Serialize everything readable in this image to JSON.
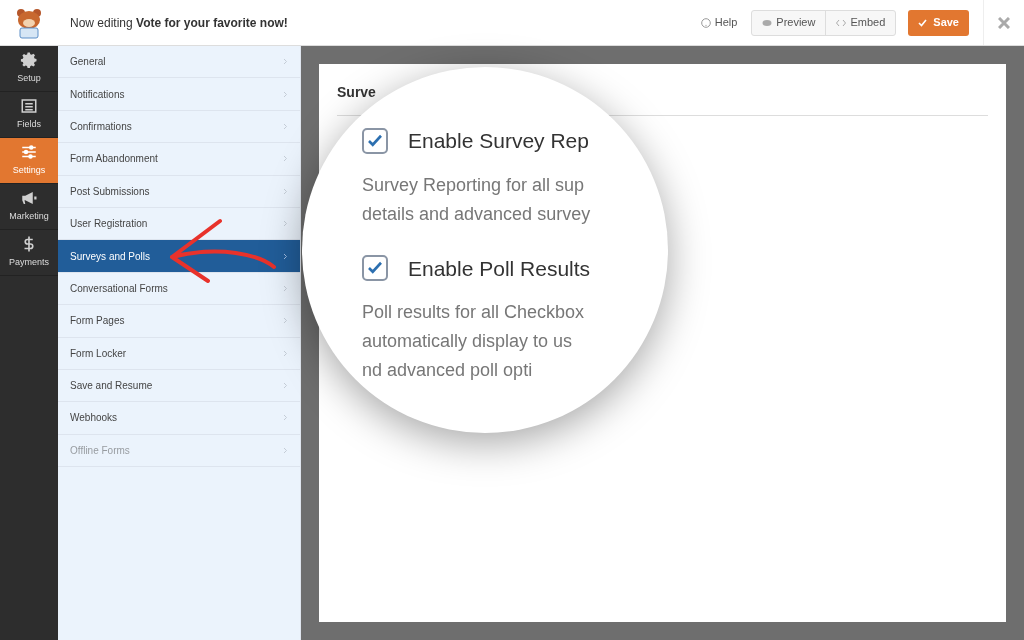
{
  "header": {
    "prefix": "Now editing ",
    "form_name": "Vote for your favorite now!",
    "help": "Help",
    "preview": "Preview",
    "embed": "Embed",
    "save": "Save"
  },
  "nav": [
    {
      "label": "Setup",
      "kind": "gear",
      "selected": false
    },
    {
      "label": "Fields",
      "kind": "fields",
      "selected": false
    },
    {
      "label": "Settings",
      "kind": "sliders",
      "selected": true
    },
    {
      "label": "Marketing",
      "kind": "megaphone",
      "selected": false
    },
    {
      "label": "Payments",
      "kind": "dollar",
      "selected": false
    }
  ],
  "settings_menu": [
    {
      "label": "General",
      "selected": false,
      "disabled": false
    },
    {
      "label": "Notifications",
      "selected": false,
      "disabled": false
    },
    {
      "label": "Confirmations",
      "selected": false,
      "disabled": false
    },
    {
      "label": "Form Abandonment",
      "selected": false,
      "disabled": false
    },
    {
      "label": "Post Submissions",
      "selected": false,
      "disabled": false
    },
    {
      "label": "User Registration",
      "selected": false,
      "disabled": false
    },
    {
      "label": "Surveys and Polls",
      "selected": true,
      "disabled": false
    },
    {
      "label": "Conversational Forms",
      "selected": false,
      "disabled": false
    },
    {
      "label": "Form Pages",
      "selected": false,
      "disabled": false
    },
    {
      "label": "Form Locker",
      "selected": false,
      "disabled": false
    },
    {
      "label": "Save and Resume",
      "selected": false,
      "disabled": false
    },
    {
      "label": "Webhooks",
      "selected": false,
      "disabled": false
    },
    {
      "label": "Offline Forms",
      "selected": false,
      "disabled": true
    }
  ],
  "panel": {
    "title": "Surve"
  },
  "magnifier": {
    "options": [
      {
        "label": "Enable Survey Rep",
        "checked": true,
        "description": [
          "Survey Reporting for all sup",
          "details and advanced survey"
        ]
      },
      {
        "label": "Enable Poll Results",
        "checked": true,
        "description": [
          "Poll results for all Checkbox",
          "automatically display to us",
          "nd advanced poll opti"
        ]
      }
    ]
  }
}
